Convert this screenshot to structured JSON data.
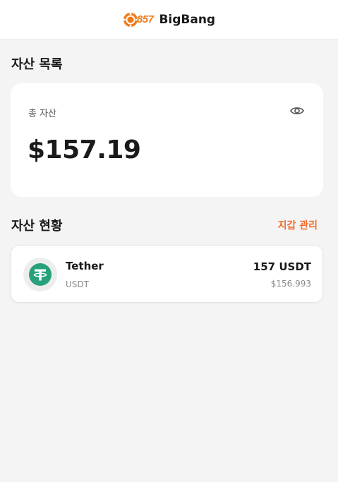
{
  "header": {
    "logo_text": "857",
    "app_title": "BigBang"
  },
  "assets_section": {
    "title": "자산 목록",
    "total_label": "총 자산",
    "total_value": "$157.19"
  },
  "holdings_section": {
    "title": "자산 현황",
    "manage_link": "지갑 관리"
  },
  "holdings": [
    {
      "name": "Tether",
      "symbol": "USDT",
      "amount": "157 USDT",
      "usd_value": "$156.993",
      "icon": "tether-icon"
    }
  ],
  "colors": {
    "accent": "#f06a2a",
    "logo_orange": "#f07a1a",
    "tether_green": "#26a17b",
    "background": "#f4f4f4",
    "card": "#ffffff"
  }
}
